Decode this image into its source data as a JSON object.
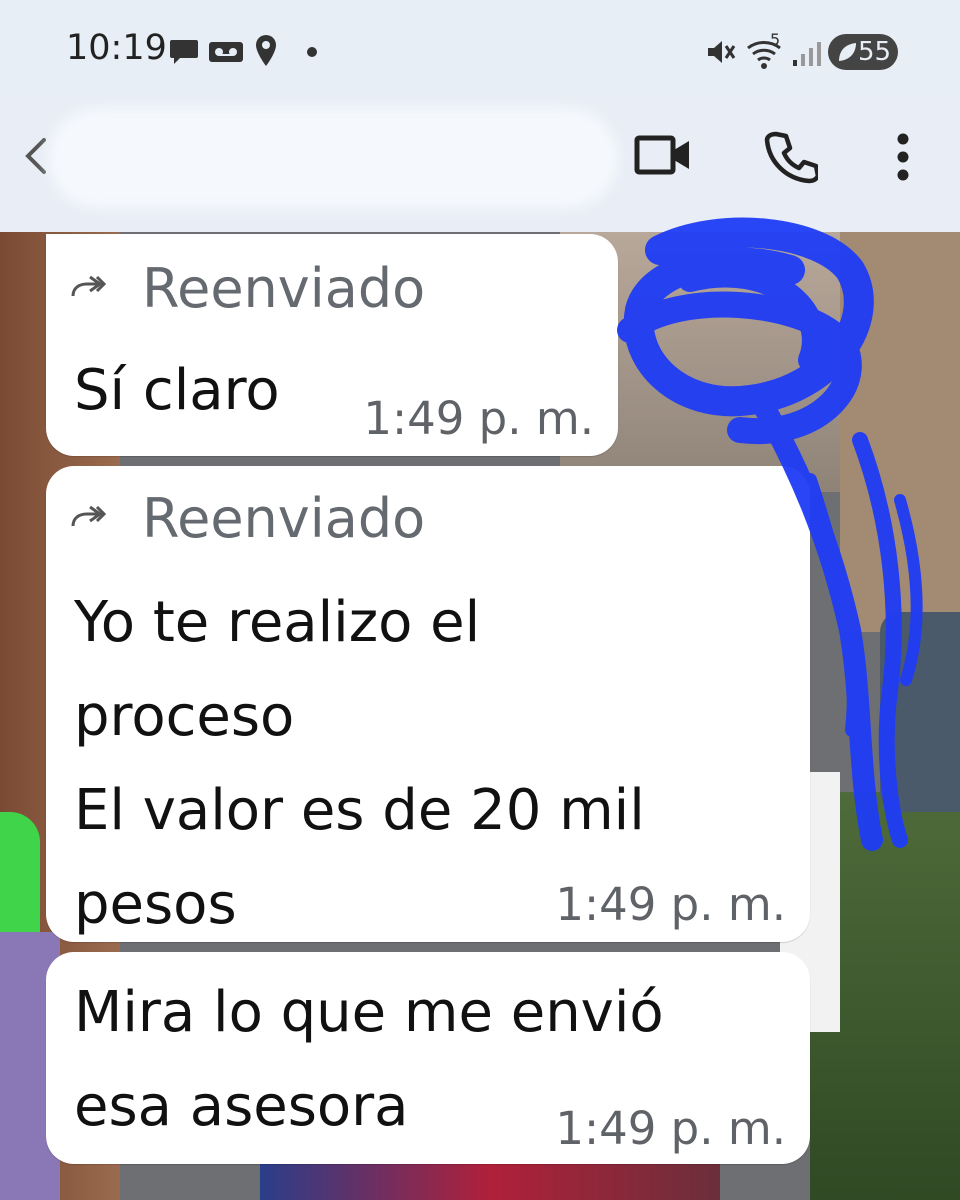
{
  "status_bar": {
    "time": "10:19",
    "left_icons": [
      "chat-notification-icon",
      "voicemail-icon",
      "location-icon",
      "dot-icon"
    ],
    "right_icons": [
      "vibrate-mute-icon",
      "wifi-icon",
      "signal-icon",
      "battery-icon"
    ],
    "wifi_label": "5",
    "battery_level": "55"
  },
  "header": {
    "back_icon": "back-arrow-icon",
    "contact_name": "",
    "actions": [
      "video-call-icon",
      "voice-call-icon",
      "more-options-icon"
    ]
  },
  "messages": [
    {
      "forwarded_label": "Reenviado",
      "text": "Sí claro",
      "time": "1:49 p. m."
    },
    {
      "forwarded_label": "Reenviado",
      "text": "Yo te realizo el\nproceso\nEl valor es de 20 mil\npesos",
      "time": "1:49 p. m."
    },
    {
      "text": "Mira lo que me envió\nesa asesora",
      "time": "1:49 p. m."
    }
  ],
  "colors": {
    "bubble": "#ffffff",
    "header_bg": "#e9eef6",
    "scribble": "#1f3cf5",
    "meta_text": "#5f6368"
  }
}
